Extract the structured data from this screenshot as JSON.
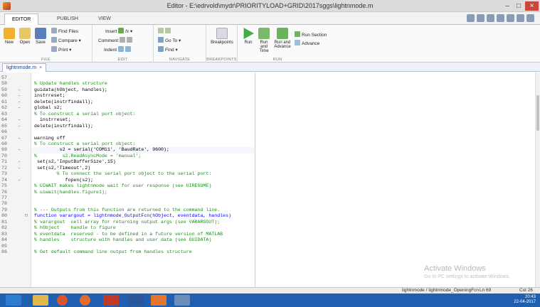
{
  "window": {
    "title": "Editor - E:\\edrvold\\mydr\\PRIORITYLOAD+GRID\\2017sggs\\lightnmode.m"
  },
  "tabs": [
    "EDITOR",
    "PUBLISH",
    "VIEW"
  ],
  "toolstrip": {
    "file": {
      "label": "FILE",
      "new": "New",
      "open": "Open",
      "save": "Save",
      "find_files": "Find Files",
      "compare": "Compare",
      "print": "Print"
    },
    "edit": {
      "label": "EDIT",
      "insert": "Insert",
      "comment": "Comment",
      "indent": "Indent"
    },
    "navigate": {
      "label": "NAVIGATE",
      "goto": "Go To",
      "find": "Find"
    },
    "breakpoints": {
      "label": "BREAKPOINTS",
      "breakpoints": "Breakpoints"
    },
    "run": {
      "label": "RUN",
      "run": "Run",
      "run_and_time": "Run and Time",
      "run_and_advance": "Run and Advance",
      "run_section": "Run Section",
      "advance": "Advance"
    }
  },
  "file_tab": {
    "name": "lightnmode.m",
    "close": "×"
  },
  "code_lines": [
    {
      "n": "57",
      "m": "",
      "t": "",
      "c": ""
    },
    {
      "n": "58",
      "m": "",
      "t": "% Update handles structure",
      "c": "comment"
    },
    {
      "n": "59",
      "m": "-",
      "t": "guidata(hObject, handles);",
      "c": ""
    },
    {
      "n": "60",
      "m": "-",
      "t": "instrreset;",
      "c": ""
    },
    {
      "n": "61",
      "m": "-",
      "t": "delete(instrfindall);",
      "c": ""
    },
    {
      "n": "62",
      "m": "-",
      "t": "global s2;",
      "c": ""
    },
    {
      "n": "63",
      "m": "",
      "t": "% To construct a serial port object:",
      "c": "comment"
    },
    {
      "n": "64",
      "m": "-",
      "t": "  instrreset;",
      "c": ""
    },
    {
      "n": "65",
      "m": "-",
      "t": "delete(instrfindall);",
      "c": ""
    },
    {
      "n": "66",
      "m": "",
      "t": "",
      "c": ""
    },
    {
      "n": "67",
      "m": "-",
      "t": "warning off",
      "c": ""
    },
    {
      "n": "68",
      "m": "",
      "t": "% To construct a serial port object:",
      "c": "comment"
    },
    {
      "n": "69",
      "m": "-",
      "t": "         s2 = serial('COM11', 'BaudRate', 9600);",
      "c": ""
    },
    {
      "n": "70",
      "m": "",
      "t": "%         s2.ReadAsyncMode = 'manual';",
      "c": "comment"
    },
    {
      "n": "71",
      "m": "-",
      "t": " set(s2,'InputBufferSize',15)",
      "c": ""
    },
    {
      "n": "72",
      "m": "-",
      "t": " set(s2,'Timeout',2)",
      "c": ""
    },
    {
      "n": "73",
      "m": "",
      "t": "        % To connect the serial port object to the serial port:",
      "c": "comment"
    },
    {
      "n": "74",
      "m": "-",
      "t": "           fopen(s2);",
      "c": ""
    },
    {
      "n": "75",
      "m": "",
      "t": "% UIWAIT makes lightnmode wait for user response (see UIRESUME)",
      "c": "comment"
    },
    {
      "n": "76",
      "m": "",
      "t": "% uiwait(handles.figure1);",
      "c": "comment"
    },
    {
      "n": "77",
      "m": "",
      "t": "",
      "c": ""
    },
    {
      "n": "78",
      "m": "",
      "t": "",
      "c": ""
    },
    {
      "n": "79",
      "m": "",
      "t": "% --- Outputs from this function are returned to the command line.",
      "c": "comment"
    },
    {
      "n": "80",
      "m": "",
      "t": "function varargout = lightnmode_OutputFcn(hObject, eventdata, handles)",
      "c": "kw-fn"
    },
    {
      "n": "81",
      "m": "",
      "t": "% varargout  cell array for returning output args (see VARARGOUT);",
      "c": "comment"
    },
    {
      "n": "82",
      "m": "",
      "t": "% hObject    handle to figure",
      "c": "comment"
    },
    {
      "n": "83",
      "m": "",
      "t": "% eventdata  reserved - to be defined in a future version of MATLAB",
      "c": "comment"
    },
    {
      "n": "84",
      "m": "",
      "t": "% handles    structure with handles and user data (see GUIDATA)",
      "c": "comment"
    },
    {
      "n": "85",
      "m": "",
      "t": "",
      "c": ""
    },
    {
      "n": "86",
      "m": "",
      "t": "% Get default command line output from handles structure",
      "c": "comment"
    }
  ],
  "watermark": {
    "title": "Activate Windows",
    "subtitle": "Go to PC settings to activate Windows."
  },
  "status": {
    "function": "lightnmode / lightnmode_OpeningFcn",
    "ln_label": "Ln",
    "ln": "69",
    "col_label": "Col",
    "col": "26"
  },
  "tray": {
    "time": "20:43",
    "date": "22-04-2017"
  },
  "colors": {
    "accent": "#1f5fb0",
    "comment": "#1f8a1f",
    "keyword": "#0000ff"
  }
}
